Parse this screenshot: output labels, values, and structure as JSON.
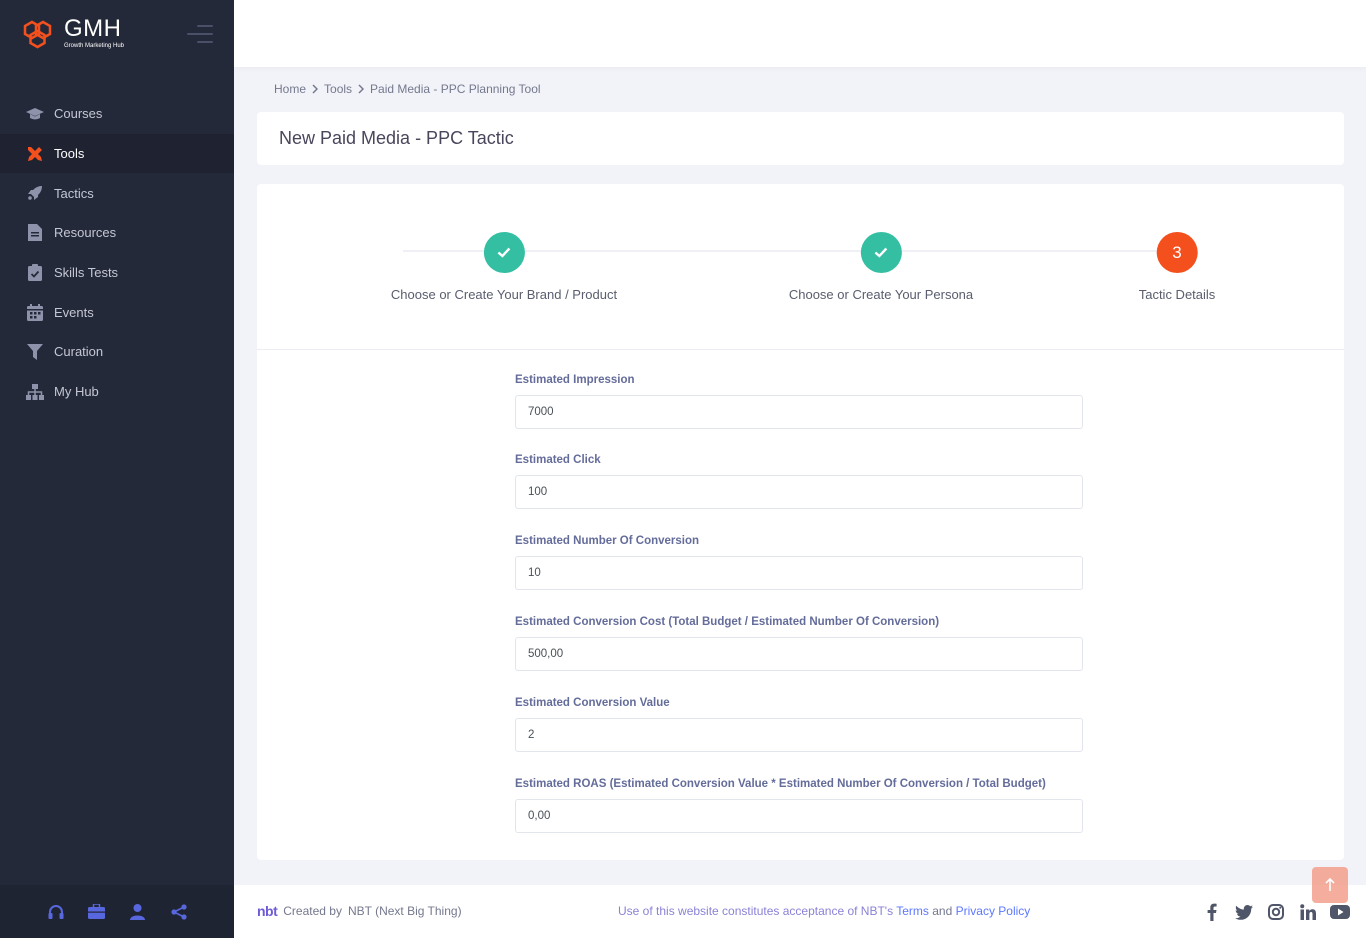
{
  "brand": {
    "title": "GMH",
    "subtitle": "Growth Marketing Hub",
    "accent": "#f4501e"
  },
  "sidebar": {
    "items": [
      {
        "label": "Courses",
        "icon": "graduation-cap-icon"
      },
      {
        "label": "Tools",
        "icon": "tools-icon",
        "active": true
      },
      {
        "label": "Tactics",
        "icon": "rocket-icon"
      },
      {
        "label": "Resources",
        "icon": "file-icon"
      },
      {
        "label": "Skills Tests",
        "icon": "clipboard-check-icon"
      },
      {
        "label": "Events",
        "icon": "calendar-icon"
      },
      {
        "label": "Curation",
        "icon": "filter-icon"
      },
      {
        "label": "My Hub",
        "icon": "sitemap-icon"
      }
    ],
    "footer_icons": [
      "headset-icon",
      "briefcase-icon",
      "user-icon",
      "share-icon"
    ]
  },
  "breadcrumb": {
    "home": "Home",
    "tools": "Tools",
    "current": "Paid Media - PPC Planning Tool"
  },
  "page": {
    "title": "New Paid Media - PPC Tactic"
  },
  "wizard": {
    "steps": [
      {
        "label": "Choose or Create Your Brand / Product",
        "status": "done"
      },
      {
        "label": "Choose or Create Your Persona",
        "status": "done"
      },
      {
        "label": "Tactic Details",
        "status": "current",
        "number": "3"
      }
    ]
  },
  "form": {
    "fields": [
      {
        "label": "Estimated Impression",
        "value": "7000"
      },
      {
        "label": "Estimated Click",
        "value": "100"
      },
      {
        "label": "Estimated Number Of Conversion",
        "value": "10"
      },
      {
        "label": "Estimated Conversion Cost (Total Budget / Estimated Number Of Conversion)",
        "value": "500,00"
      },
      {
        "label": "Estimated Conversion Value",
        "value": "2"
      },
      {
        "label": "Estimated ROAS (Estimated Conversion Value * Estimated Number Of Conversion / Total Budget)",
        "value": "0,00"
      }
    ]
  },
  "footer": {
    "logo": "nbt",
    "created_by": "Created by",
    "company": "NBT (Next Big Thing)",
    "notice_prefix": "Use of this website constitutes acceptance of NBT's",
    "terms": "Terms",
    "and": "and",
    "privacy": "Privacy Policy",
    "social": [
      "facebook-icon",
      "twitter-icon",
      "instagram-icon",
      "linkedin-icon",
      "youtube-icon"
    ]
  }
}
